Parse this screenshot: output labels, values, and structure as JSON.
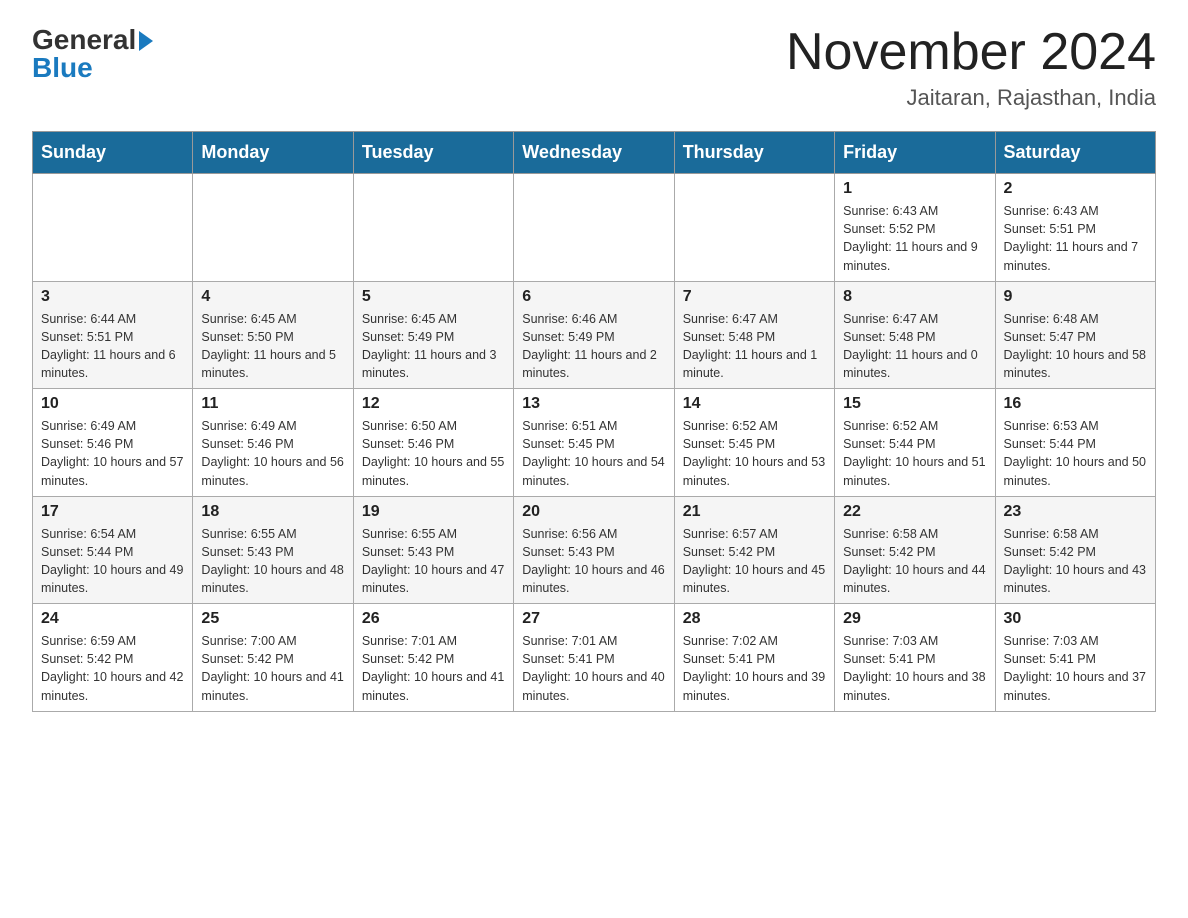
{
  "header": {
    "logo_general": "General",
    "logo_blue": "Blue",
    "title": "November 2024",
    "subtitle": "Jaitaran, Rajasthan, India"
  },
  "days_of_week": [
    "Sunday",
    "Monday",
    "Tuesday",
    "Wednesday",
    "Thursday",
    "Friday",
    "Saturday"
  ],
  "weeks": [
    {
      "days": [
        {
          "num": "",
          "info": ""
        },
        {
          "num": "",
          "info": ""
        },
        {
          "num": "",
          "info": ""
        },
        {
          "num": "",
          "info": ""
        },
        {
          "num": "",
          "info": ""
        },
        {
          "num": "1",
          "info": "Sunrise: 6:43 AM\nSunset: 5:52 PM\nDaylight: 11 hours and 9 minutes."
        },
        {
          "num": "2",
          "info": "Sunrise: 6:43 AM\nSunset: 5:51 PM\nDaylight: 11 hours and 7 minutes."
        }
      ]
    },
    {
      "days": [
        {
          "num": "3",
          "info": "Sunrise: 6:44 AM\nSunset: 5:51 PM\nDaylight: 11 hours and 6 minutes."
        },
        {
          "num": "4",
          "info": "Sunrise: 6:45 AM\nSunset: 5:50 PM\nDaylight: 11 hours and 5 minutes."
        },
        {
          "num": "5",
          "info": "Sunrise: 6:45 AM\nSunset: 5:49 PM\nDaylight: 11 hours and 3 minutes."
        },
        {
          "num": "6",
          "info": "Sunrise: 6:46 AM\nSunset: 5:49 PM\nDaylight: 11 hours and 2 minutes."
        },
        {
          "num": "7",
          "info": "Sunrise: 6:47 AM\nSunset: 5:48 PM\nDaylight: 11 hours and 1 minute."
        },
        {
          "num": "8",
          "info": "Sunrise: 6:47 AM\nSunset: 5:48 PM\nDaylight: 11 hours and 0 minutes."
        },
        {
          "num": "9",
          "info": "Sunrise: 6:48 AM\nSunset: 5:47 PM\nDaylight: 10 hours and 58 minutes."
        }
      ]
    },
    {
      "days": [
        {
          "num": "10",
          "info": "Sunrise: 6:49 AM\nSunset: 5:46 PM\nDaylight: 10 hours and 57 minutes."
        },
        {
          "num": "11",
          "info": "Sunrise: 6:49 AM\nSunset: 5:46 PM\nDaylight: 10 hours and 56 minutes."
        },
        {
          "num": "12",
          "info": "Sunrise: 6:50 AM\nSunset: 5:46 PM\nDaylight: 10 hours and 55 minutes."
        },
        {
          "num": "13",
          "info": "Sunrise: 6:51 AM\nSunset: 5:45 PM\nDaylight: 10 hours and 54 minutes."
        },
        {
          "num": "14",
          "info": "Sunrise: 6:52 AM\nSunset: 5:45 PM\nDaylight: 10 hours and 53 minutes."
        },
        {
          "num": "15",
          "info": "Sunrise: 6:52 AM\nSunset: 5:44 PM\nDaylight: 10 hours and 51 minutes."
        },
        {
          "num": "16",
          "info": "Sunrise: 6:53 AM\nSunset: 5:44 PM\nDaylight: 10 hours and 50 minutes."
        }
      ]
    },
    {
      "days": [
        {
          "num": "17",
          "info": "Sunrise: 6:54 AM\nSunset: 5:44 PM\nDaylight: 10 hours and 49 minutes."
        },
        {
          "num": "18",
          "info": "Sunrise: 6:55 AM\nSunset: 5:43 PM\nDaylight: 10 hours and 48 minutes."
        },
        {
          "num": "19",
          "info": "Sunrise: 6:55 AM\nSunset: 5:43 PM\nDaylight: 10 hours and 47 minutes."
        },
        {
          "num": "20",
          "info": "Sunrise: 6:56 AM\nSunset: 5:43 PM\nDaylight: 10 hours and 46 minutes."
        },
        {
          "num": "21",
          "info": "Sunrise: 6:57 AM\nSunset: 5:42 PM\nDaylight: 10 hours and 45 minutes."
        },
        {
          "num": "22",
          "info": "Sunrise: 6:58 AM\nSunset: 5:42 PM\nDaylight: 10 hours and 44 minutes."
        },
        {
          "num": "23",
          "info": "Sunrise: 6:58 AM\nSunset: 5:42 PM\nDaylight: 10 hours and 43 minutes."
        }
      ]
    },
    {
      "days": [
        {
          "num": "24",
          "info": "Sunrise: 6:59 AM\nSunset: 5:42 PM\nDaylight: 10 hours and 42 minutes."
        },
        {
          "num": "25",
          "info": "Sunrise: 7:00 AM\nSunset: 5:42 PM\nDaylight: 10 hours and 41 minutes."
        },
        {
          "num": "26",
          "info": "Sunrise: 7:01 AM\nSunset: 5:42 PM\nDaylight: 10 hours and 41 minutes."
        },
        {
          "num": "27",
          "info": "Sunrise: 7:01 AM\nSunset: 5:41 PM\nDaylight: 10 hours and 40 minutes."
        },
        {
          "num": "28",
          "info": "Sunrise: 7:02 AM\nSunset: 5:41 PM\nDaylight: 10 hours and 39 minutes."
        },
        {
          "num": "29",
          "info": "Sunrise: 7:03 AM\nSunset: 5:41 PM\nDaylight: 10 hours and 38 minutes."
        },
        {
          "num": "30",
          "info": "Sunrise: 7:03 AM\nSunset: 5:41 PM\nDaylight: 10 hours and 37 minutes."
        }
      ]
    }
  ]
}
